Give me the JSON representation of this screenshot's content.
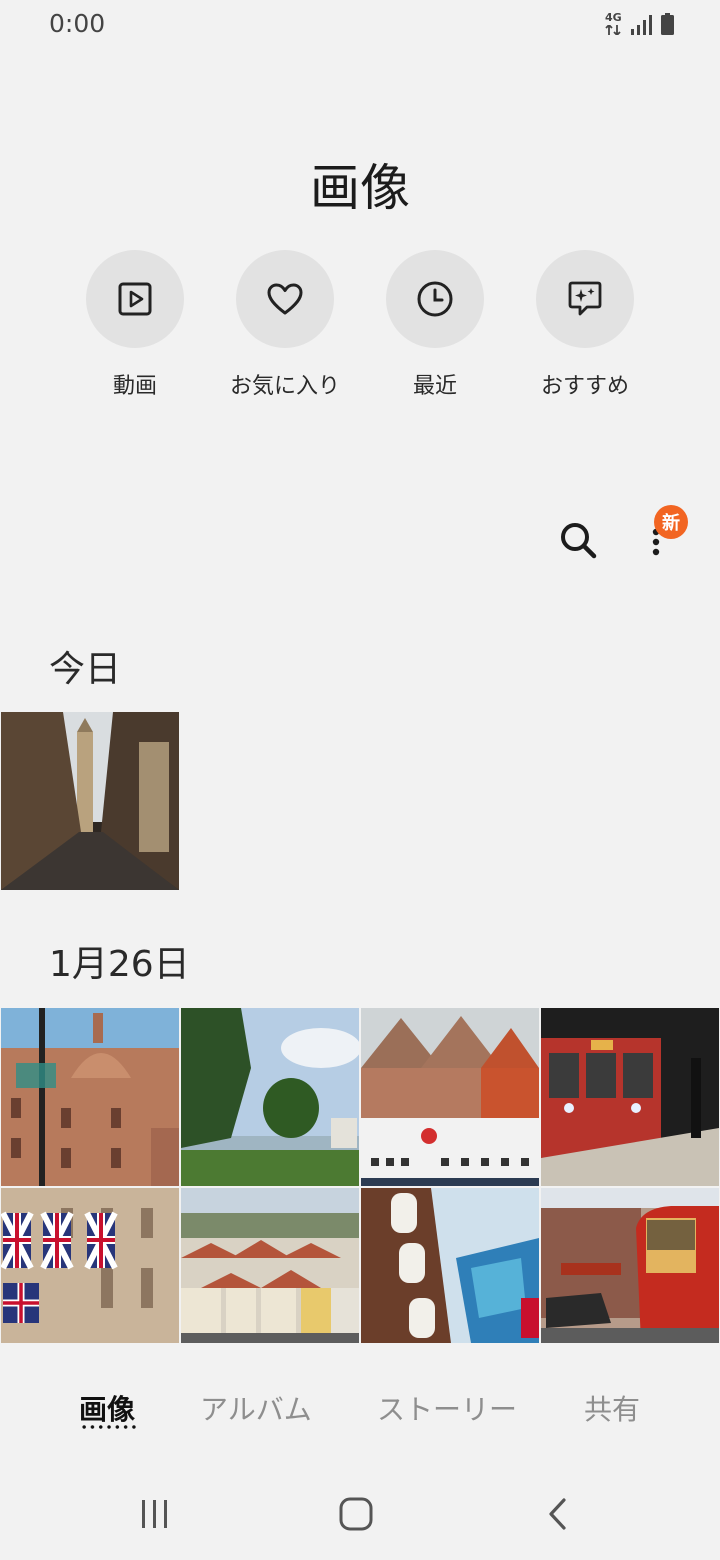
{
  "status_bar": {
    "time": "0:00",
    "network": "4G"
  },
  "title": "画像",
  "shortcuts": [
    {
      "label": "動画",
      "icon": "play-video-icon"
    },
    {
      "label": "お気に入り",
      "icon": "heart-icon"
    },
    {
      "label": "最近",
      "icon": "clock-icon"
    },
    {
      "label": "おすすめ",
      "icon": "sparkle-chat-icon"
    }
  ],
  "toolbar": {
    "badge": "新"
  },
  "sections": [
    {
      "header": "今日",
      "photos": [
        "narrow-street-with-tower"
      ]
    },
    {
      "header": "1月26日",
      "photos": [
        "ornate-dome-building",
        "park-with-trees",
        "brick-buildings-with-boat",
        "subway-train-at-station",
        "buildings-with-union-jack-flags",
        "city-rooftops-panorama",
        "shop-signs-with-lanterns",
        "red-bus-on-street"
      ]
    }
  ],
  "bottom_tabs": [
    {
      "label": "画像",
      "active": true
    },
    {
      "label": "アルバム",
      "active": false
    },
    {
      "label": "ストーリー",
      "active": false
    },
    {
      "label": "共有",
      "active": false
    }
  ],
  "colors": {
    "background": "#f2f2f2",
    "badge": "#f26522",
    "circle": "#e2e2e2"
  }
}
